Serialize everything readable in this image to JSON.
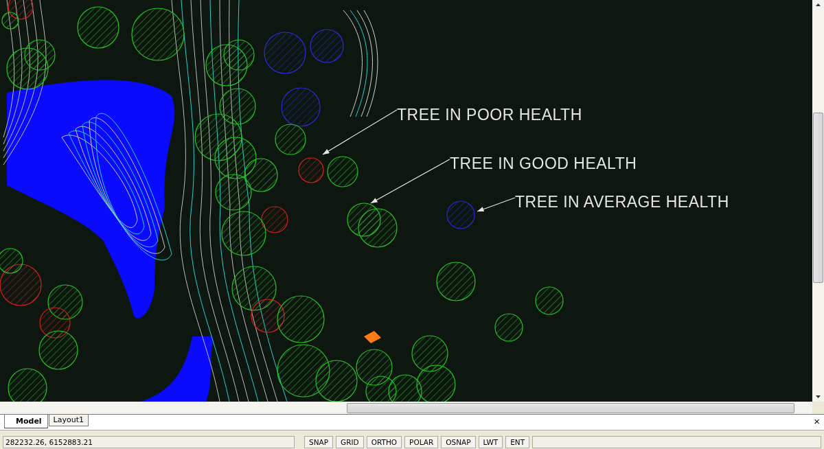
{
  "drawing": {
    "annotations": [
      {
        "text": "TREE IN POOR HEALTH"
      },
      {
        "text": "TREE IN GOOD HEALTH"
      },
      {
        "text": "TREE IN AVERAGE HEALTH"
      }
    ]
  },
  "tabs": [
    {
      "label": "Model",
      "selected": true
    },
    {
      "label": "Layout1",
      "selected": false
    }
  ],
  "close_glyph": "×",
  "status_bar": {
    "coordinates": "282232.26,  6152883.21",
    "toggles": [
      "SNAP",
      "GRID",
      "ORTHO",
      "POLAR",
      "OSNAP",
      "LWT",
      "ENT"
    ]
  }
}
